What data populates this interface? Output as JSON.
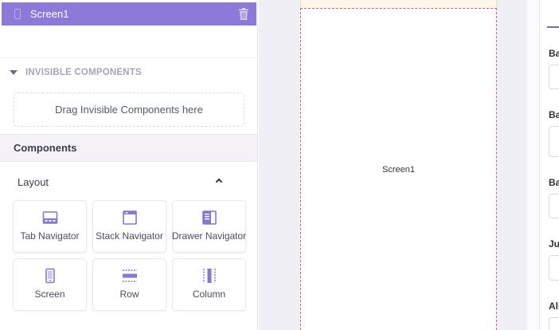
{
  "tree": {
    "screen_label": "Screen1"
  },
  "invisible": {
    "heading": "INVISIBLE COMPONENTS",
    "drop_text": "Drag Invisible Components here"
  },
  "palette": {
    "heading": "Components",
    "section": "Layout",
    "items": [
      {
        "label": "Tab Navigator",
        "icon": "tab-navigator-icon"
      },
      {
        "label": "Stack Navigator",
        "icon": "stack-navigator-icon"
      },
      {
        "label": "Drawer Navigator",
        "icon": "drawer-navigator-icon"
      },
      {
        "label": "Screen",
        "icon": "screen-icon"
      },
      {
        "label": "Row",
        "icon": "row-icon"
      },
      {
        "label": "Column",
        "icon": "column-icon"
      }
    ]
  },
  "canvas": {
    "screen_name": "Screen1"
  },
  "properties": {
    "labels": [
      "Ba",
      "Ba",
      "Ba",
      "Ju",
      "Ali"
    ]
  },
  "colors": {
    "accent": "#8b7ad8",
    "icon": "#8677d3",
    "canvas_bg": "#f0eff6",
    "device_border": "#e2605e"
  }
}
